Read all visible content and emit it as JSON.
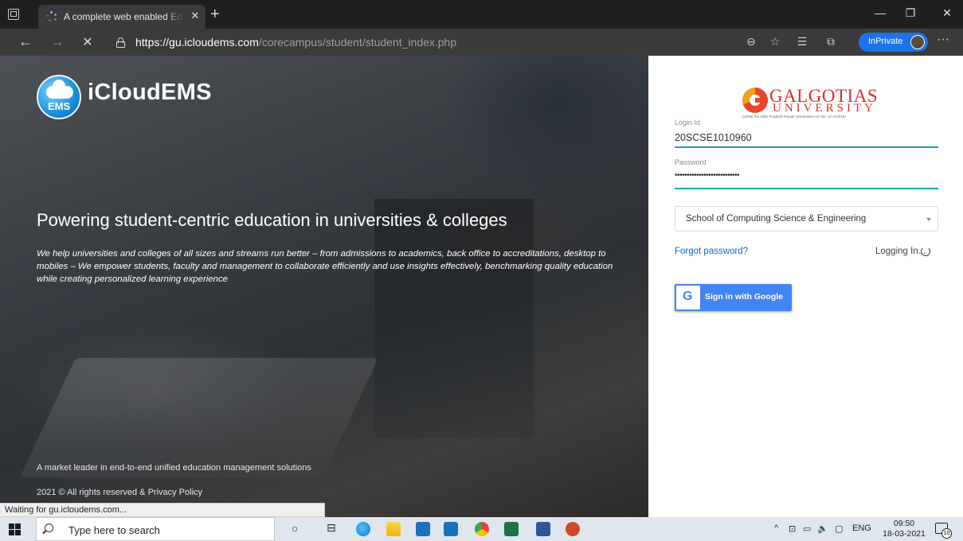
{
  "browser": {
    "tab_title": "A complete web enabled Education",
    "url_scheme": "https://",
    "url_host": "gu.icloudems.com",
    "url_path": "/corecampus/student/student_index.php",
    "inprivate_label": "InPrivate",
    "status_text": "Waiting for gu.icloudems.com..."
  },
  "hero": {
    "brand": "iCloudEMS",
    "logo_text": "EMS",
    "headline": "Powering student-centric education in universities & colleges",
    "description": "We help universities and colleges of all sizes and streams run better – from admissions to academics, back office to accreditations, desktop to mobiles – We empower students, faculty and management to collaborate efficiently and use insights effectively, benchmarking quality education while creating personalized learning experience",
    "tagline": "A market leader in end-to-end unified education management solutions",
    "copyright": "2021 © All rights reserved & Privacy Policy"
  },
  "login": {
    "university_name": "GALGOTIAS",
    "university_sub": "UNIVERSITY",
    "university_note": "(Under the Uttar Pradesh Private Universities Act No. 12 of 2019)",
    "login_id_label": "Login Id",
    "login_id_value": "20SCSE1010960",
    "password_label": "Password",
    "password_value": "•••••••••••••••••••••••••••",
    "school_selected": "School of Computing Science & Engineering",
    "forgot_password": "Forgot password?",
    "logging_in": "Logging In...",
    "google_button": "Sign in with Google",
    "accent_color": "#1ba5a5"
  },
  "taskbar": {
    "search_placeholder": "Type here to search",
    "language": "ENG",
    "time": "09:50",
    "date": "18-03-2021",
    "notification_count": "10"
  }
}
